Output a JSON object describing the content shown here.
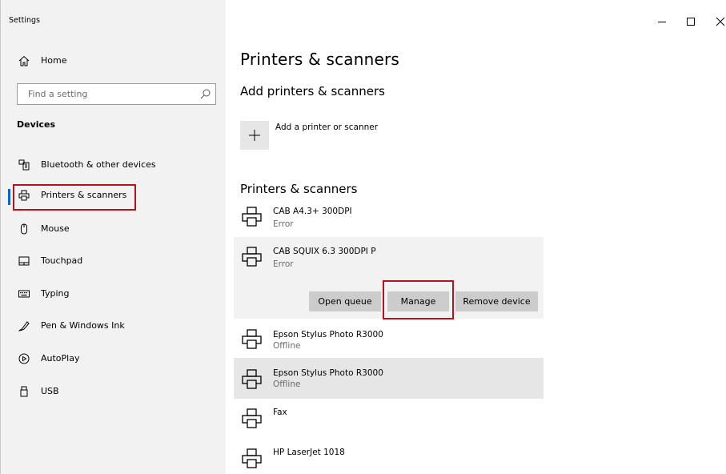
{
  "window": {
    "title": "Settings"
  },
  "sidebar": {
    "home_label": "Home",
    "search_placeholder": "Find a setting",
    "section": "Devices",
    "items": [
      {
        "label": "Bluetooth & other devices",
        "icon": "bluetooth-devices-icon"
      },
      {
        "label": "Printers & scanners",
        "icon": "printer-icon",
        "selected": true
      },
      {
        "label": "Mouse",
        "icon": "mouse-icon"
      },
      {
        "label": "Touchpad",
        "icon": "touchpad-icon"
      },
      {
        "label": "Typing",
        "icon": "keyboard-icon"
      },
      {
        "label": "Pen & Windows Ink",
        "icon": "pen-icon"
      },
      {
        "label": "AutoPlay",
        "icon": "autoplay-icon"
      },
      {
        "label": "USB",
        "icon": "usb-icon"
      }
    ]
  },
  "main": {
    "title": "Printers & scanners",
    "add_heading": "Add printers & scanners",
    "add_label": "Add a printer or scanner",
    "list_heading": "Printers & scanners",
    "printers": [
      {
        "name": "CAB A4.3+ 300DPI",
        "status": "Error"
      },
      {
        "name": "CAB SQUIX 6.3 300DPI P",
        "status": "Error",
        "expanded": true
      },
      {
        "name": "Epson Stylus Photo R3000",
        "status": "Offline"
      },
      {
        "name": "Epson Stylus Photo R3000",
        "status": "Offline",
        "hovered": true
      },
      {
        "name": "Fax",
        "status": ""
      },
      {
        "name": "HP LaserJet 1018",
        "status": ""
      }
    ],
    "buttons": {
      "open_queue": "Open queue",
      "manage": "Manage",
      "remove": "Remove device"
    }
  },
  "colors": {
    "sidebar_bg": "#f2f2f2",
    "accent": "#0a64c8",
    "highlight": "#b4141e",
    "button_bg": "#cccccc"
  }
}
